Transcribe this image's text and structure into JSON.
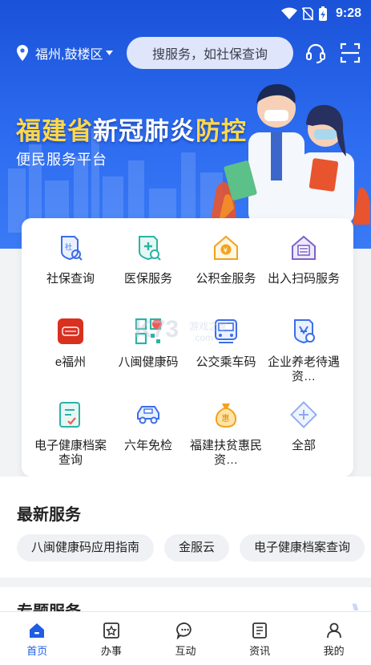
{
  "status_bar": {
    "time": "9:28"
  },
  "header": {
    "location": "福州,鼓楼区",
    "search_placeholder": "搜服务，如社保查询",
    "icons": [
      "location-pin-icon",
      "caret-down-icon",
      "headset-icon",
      "scan-icon"
    ]
  },
  "banner": {
    "title_part1": "福建省",
    "title_part2": "新冠肺炎",
    "title_part3": "防控",
    "subtitle": "便民服务平台"
  },
  "services": [
    {
      "label": "社保查询",
      "icon": "social-security-icon"
    },
    {
      "label": "医保服务",
      "icon": "medical-insurance-icon"
    },
    {
      "label": "公积金服务",
      "icon": "housing-fund-icon"
    },
    {
      "label": "出入扫码服务",
      "icon": "entry-scan-icon"
    },
    {
      "label": "e福州",
      "icon": "efuzhou-icon"
    },
    {
      "label": "八闽健康码",
      "icon": "health-code-icon"
    },
    {
      "label": "公交乘车码",
      "icon": "bus-code-icon"
    },
    {
      "label": "企业养老待遇资…",
      "icon": "pension-icon"
    },
    {
      "label": "电子健康档案查询",
      "icon": "health-record-icon"
    },
    {
      "label": "六年免检",
      "icon": "car-inspection-icon"
    },
    {
      "label": "福建扶贫惠民资…",
      "icon": "poverty-relief-icon"
    },
    {
      "label": "全部",
      "icon": "all-services-icon"
    }
  ],
  "latest": {
    "title": "最新服务",
    "chips": [
      "八闽健康码应用指南",
      "金服云",
      "电子健康档案查询"
    ]
  },
  "topics": {
    "title": "专题服务"
  },
  "watermark": {
    "brand": "K73",
    "text": "游戏之家",
    "domain": ".com"
  },
  "bottom_nav": [
    {
      "label": "首页",
      "icon": "home-icon",
      "active": true
    },
    {
      "label": "办事",
      "icon": "affairs-icon",
      "active": false
    },
    {
      "label": "互动",
      "icon": "chat-icon",
      "active": false
    },
    {
      "label": "资讯",
      "icon": "news-icon",
      "active": false
    },
    {
      "label": "我的",
      "icon": "user-icon",
      "active": false
    }
  ],
  "colors": {
    "primary": "#1f5de4",
    "banner_gold": "#ffd84a",
    "icon_teal": "#2bb3a6",
    "icon_blue": "#3d6ee8",
    "icon_orange": "#f2a21d",
    "icon_red": "#d9301f"
  }
}
